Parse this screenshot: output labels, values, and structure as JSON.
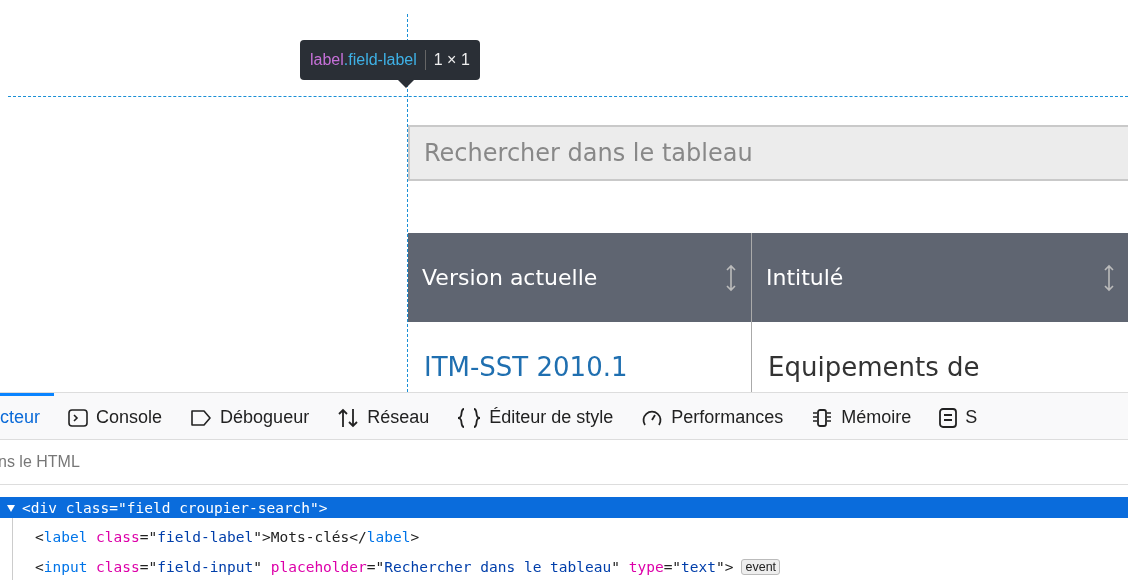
{
  "tooltip": {
    "tag": "label",
    "class_name": ".field-label",
    "size": "1 × 1"
  },
  "search": {
    "placeholder": "Rechercher dans le tableau"
  },
  "table": {
    "columns": [
      "Version actuelle",
      "Intitulé"
    ],
    "rows": [
      [
        "ITM-SST 2010.1",
        "Equipements de"
      ]
    ]
  },
  "devtools": {
    "tabs": [
      {
        "label": "cteur",
        "selected": true
      },
      {
        "label": "Console",
        "selected": false
      },
      {
        "label": "Débogueur",
        "selected": false
      },
      {
        "label": "Réseau",
        "selected": false
      },
      {
        "label": "Éditeur de style",
        "selected": false
      },
      {
        "label": "Performances",
        "selected": false
      },
      {
        "label": "Mémoire",
        "selected": false
      },
      {
        "label": "S",
        "selected": false
      }
    ],
    "search": {
      "placeholder": "ns le HTML"
    },
    "tree": [
      {
        "selected": true,
        "expanded": true,
        "text": "<div class=\"field croupier-search\">",
        "children": [
          {
            "selected": false,
            "tokens": [
              {
                "kind": "punct",
                "text": "<"
              },
              {
                "kind": "tag",
                "text": "label"
              },
              {
                "kind": "attr",
                "text": " class"
              },
              {
                "kind": "punct",
                "text": "=\""
              },
              {
                "kind": "value",
                "text": "field-label"
              },
              {
                "kind": "punct",
                "text": "\">"
              },
              {
                "kind": "text",
                "text": "Mots-clés"
              },
              {
                "kind": "punct",
                "text": "</"
              },
              {
                "kind": "tag",
                "text": "label"
              },
              {
                "kind": "punct",
                "text": ">"
              }
            ]
          },
          {
            "selected": false,
            "badge": "event",
            "tokens": [
              {
                "kind": "punct",
                "text": "<"
              },
              {
                "kind": "tag",
                "text": "input"
              },
              {
                "kind": "attr",
                "text": " class"
              },
              {
                "kind": "punct",
                "text": "=\""
              },
              {
                "kind": "value",
                "text": "field-input"
              },
              {
                "kind": "punct",
                "text": "\""
              },
              {
                "kind": "attr",
                "text": " placeholder"
              },
              {
                "kind": "punct",
                "text": "=\""
              },
              {
                "kind": "value",
                "text": "Rechercher dans le tableau"
              },
              {
                "kind": "punct",
                "text": "\""
              },
              {
                "kind": "attr",
                "text": " type"
              },
              {
                "kind": "punct",
                "text": "=\""
              },
              {
                "kind": "value",
                "text": "text"
              },
              {
                "kind": "punct",
                "text": "\">"
              }
            ]
          }
        ]
      }
    ]
  }
}
